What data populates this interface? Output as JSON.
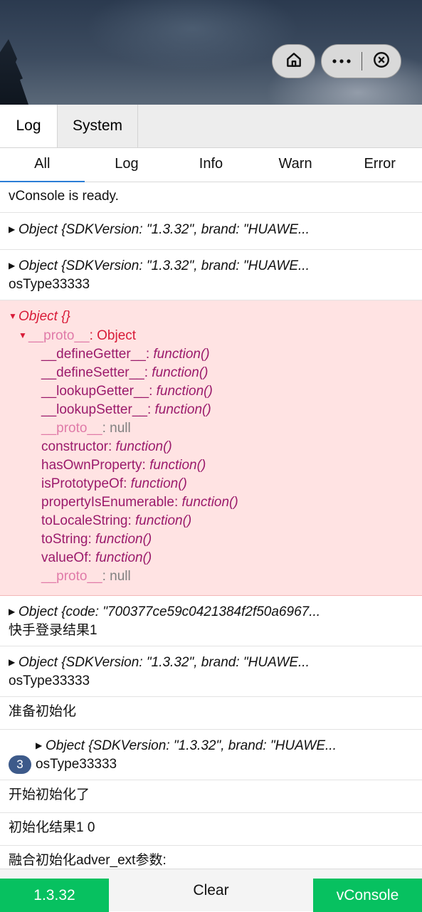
{
  "top_bar": {
    "home_icon": "home-icon",
    "more_icon": "more-dots-icon",
    "close_icon": "close-circle-icon"
  },
  "tabs": [
    {
      "label": "Log"
    },
    {
      "label": "System"
    }
  ],
  "filters": [
    {
      "label": "All"
    },
    {
      "label": "Log"
    },
    {
      "label": "Info"
    },
    {
      "label": "Warn"
    },
    {
      "label": "Error"
    }
  ],
  "logs": {
    "r1": "vConsole is ready.",
    "r2": "Object {SDKVersion: \"1.3.32\", brand: \"HUAWE...",
    "r3_obj": "Object {SDKVersion: \"1.3.32\", brand: \"HUAWE...",
    "r3_text": "osType33333",
    "err_obj": "Object {}",
    "err_proto_key": "__proto__",
    "err_proto_val": "Object",
    "err_items": [
      {
        "key": "__defineGetter__",
        "val": "function()"
      },
      {
        "key": "__defineSetter__",
        "val": "function()"
      },
      {
        "key": "__lookupGetter__",
        "val": "function()"
      },
      {
        "key": "__lookupSetter__",
        "val": "function()"
      },
      {
        "key": "__proto__",
        "val": "null"
      },
      {
        "key": "constructor",
        "val": "function()"
      },
      {
        "key": "hasOwnProperty",
        "val": "function()"
      },
      {
        "key": "isPrototypeOf",
        "val": "function()"
      },
      {
        "key": "propertyIsEnumerable",
        "val": "function()"
      },
      {
        "key": "toLocaleString",
        "val": "function()"
      },
      {
        "key": "toString",
        "val": "function()"
      },
      {
        "key": "valueOf",
        "val": "function()"
      },
      {
        "key": "__proto__",
        "val": "null"
      }
    ],
    "r5_obj": "Object {code: \"700377ce59c0421384f2f50a6967...",
    "r5_text": "快手登录结果1",
    "r6_obj": "Object {SDKVersion: \"1.3.32\", brand: \"HUAWE...",
    "r6_text": "osType33333",
    "r7": "准备初始化",
    "r8_obj": "Object {SDKVersion: \"1.3.32\", brand: \"HUAWE...",
    "r8_count": "3",
    "r8_text": "osType33333",
    "r9": "开始初始化了",
    "r10": "初始化结果1 0",
    "r11": "融合初始化adver_ext参数:"
  },
  "footer": {
    "version": "1.3.32",
    "clear": "Clear",
    "vconsole": "vConsole"
  }
}
